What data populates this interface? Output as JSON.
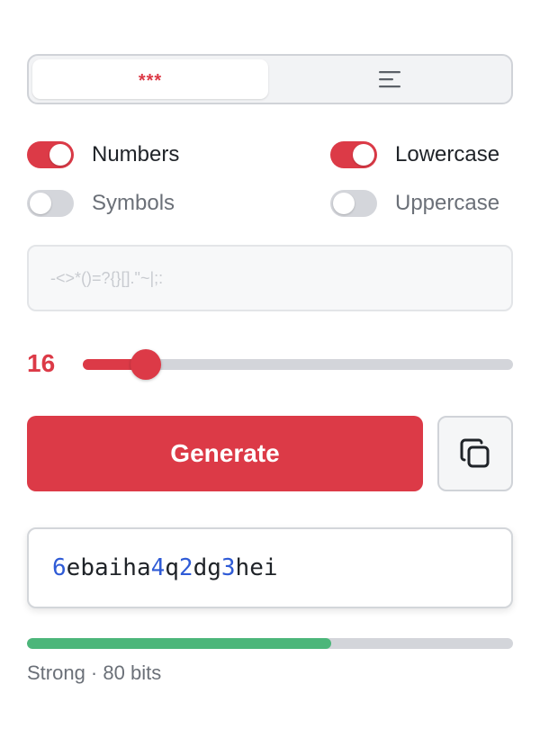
{
  "mode_tabs": [
    {
      "id": "password",
      "label": "***",
      "icon": "asterisks-icon",
      "active": true
    },
    {
      "id": "passphrase",
      "label": "",
      "icon": "lines-icon",
      "active": false
    }
  ],
  "options": [
    {
      "name": "numbers",
      "label": "Numbers",
      "on": true
    },
    {
      "name": "lowercase",
      "label": "Lowercase",
      "on": true
    },
    {
      "name": "symbols",
      "label": "Symbols",
      "on": false
    },
    {
      "name": "uppercase",
      "label": "Uppercase",
      "on": false
    }
  ],
  "symbols_field": {
    "placeholder": "-<>*()=?{}[].\"~|;:",
    "value": ""
  },
  "length": {
    "value": "16",
    "slider_fraction": 0.075
  },
  "generate_label": "Generate",
  "copy_icon": "copy-icon",
  "password": "6ebaiha4q2dg3hei",
  "strength": {
    "label": "Strong · 80 bits",
    "fraction": 0.625,
    "color": "#4cb67a"
  },
  "colors": {
    "accent": "#dc3a47",
    "digit": "#2f5bd6"
  }
}
